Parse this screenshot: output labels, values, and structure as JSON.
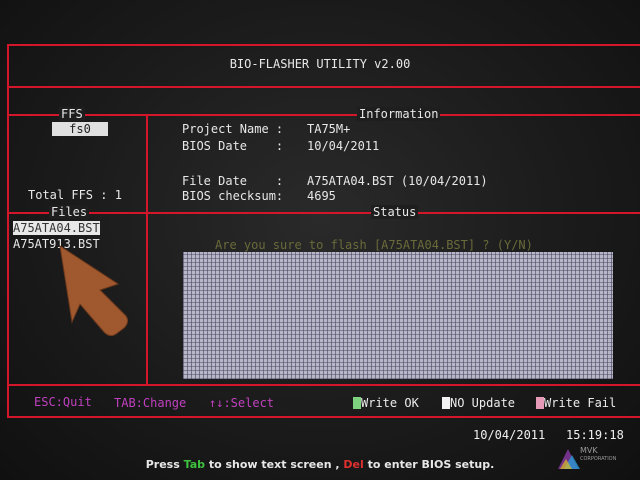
{
  "title": "BIO-FLASHER UTILITY v2.00",
  "ffs": {
    "label": "FFS",
    "value": "fs0",
    "total": "Total FFS : 1"
  },
  "information": {
    "label": "Information",
    "rows": [
      {
        "key": "Project Name :",
        "value": "TA75M+"
      },
      {
        "key": "BIOS Date    :",
        "value": "10/04/2011"
      },
      {
        "key": "File Date    :",
        "value": "A75ATA04.BST (10/04/2011)"
      },
      {
        "key": "BIOS checksum:",
        "value": "4695"
      }
    ]
  },
  "files": {
    "label": "Files",
    "items": [
      {
        "name": "A75ATA04.BST",
        "selected": true
      },
      {
        "name": "A75AT913.BST",
        "selected": false
      }
    ]
  },
  "status": {
    "label": "Status",
    "prompt": "Are you sure to flash [A75ATA04.BST] ? (Y/N)"
  },
  "help": {
    "esc": "ESC:Quit",
    "tab": "TAB:Change",
    "select": "↑↓:Select"
  },
  "legend": [
    {
      "label": "Write OK",
      "color": "#7ed47e"
    },
    {
      "label": "NO Update",
      "color": "#f2f2f2"
    },
    {
      "label": "Write Fail",
      "color": "#e79ab8"
    }
  ],
  "datetime": {
    "date": "10/04/2011",
    "time": "15:19:18"
  },
  "footer": {
    "part1": "Press",
    "key1": "Tab",
    "part2": "to show text screen ,",
    "key2": "Del",
    "part3": "to enter BIOS setup."
  },
  "logo": {
    "name": "MVK",
    "sub": "CORPORATION"
  },
  "colors": {
    "frame": "#d4162a",
    "help_text": "#c040c0",
    "prompt_text": "#6a6a3a"
  }
}
